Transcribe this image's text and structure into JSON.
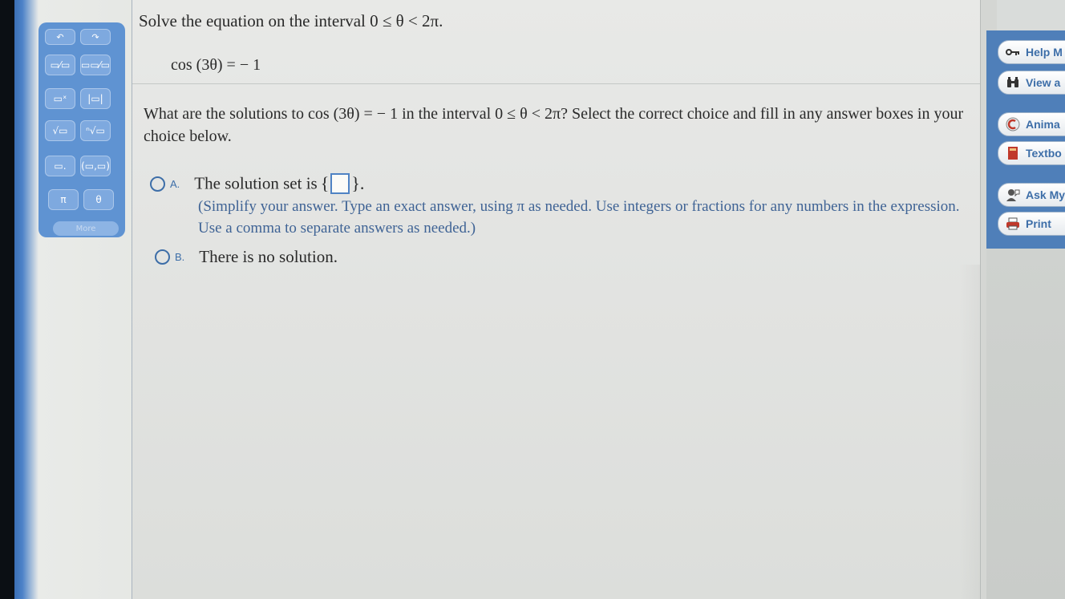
{
  "palette": {
    "buttons": [
      {
        "name": "undo-button",
        "glyph": "↶"
      },
      {
        "name": "redo-button",
        "glyph": "↷"
      },
      {
        "name": "fraction-button",
        "glyph": "▭⁄▭"
      },
      {
        "name": "mixed-number-button",
        "glyph": "▭▭⁄▭"
      },
      {
        "name": "exponent-button",
        "glyph": "▭ˣ"
      },
      {
        "name": "absolute-value-button",
        "glyph": "|▭|"
      },
      {
        "name": "square-root-button",
        "glyph": "√▭"
      },
      {
        "name": "nth-root-button",
        "glyph": "ⁿ√▭"
      },
      {
        "name": "decimal-button",
        "glyph": "▭."
      },
      {
        "name": "ordered-pair-button",
        "glyph": "(▭,▭)"
      },
      {
        "name": "pi-button",
        "glyph": "π"
      },
      {
        "name": "theta-button",
        "glyph": "θ"
      }
    ],
    "more_label": "More"
  },
  "problem": {
    "title": "Solve the equation on the interval 0 ≤ θ < 2π.",
    "equation": "cos (3θ) = − 1",
    "question": "What are the solutions to cos (3θ) = − 1 in the interval 0 ≤ θ < 2π? Select the correct choice and fill in any answer boxes in your choice below."
  },
  "choices": {
    "a": {
      "letter": "A.",
      "text_before": "The solution set is",
      "brace_open": "{",
      "brace_close": "}.",
      "hint": "(Simplify your answer. Type an exact answer, using π as needed. Use integers or fractions for any numbers in the expression. Use a comma to separate answers as needed.)"
    },
    "b": {
      "letter": "B.",
      "text": "There is no solution."
    }
  },
  "tools": [
    {
      "name": "help-me-solve",
      "label": "Help M",
      "icon": "key-icon"
    },
    {
      "name": "view-an-example",
      "label": "View a",
      "icon": "binoculars-icon"
    },
    {
      "name": "animation",
      "label": "Anima",
      "icon": "animation-icon"
    },
    {
      "name": "textbook",
      "label": "Textbo",
      "icon": "book-icon"
    },
    {
      "name": "ask-my-instructor",
      "label": "Ask My",
      "icon": "person-icon"
    },
    {
      "name": "print",
      "label": "Print",
      "icon": "printer-icon"
    }
  ],
  "colors": {
    "accent": "#3d6ea8",
    "hint_text": "#3f6395",
    "palette_bg": "#5f93d2"
  }
}
